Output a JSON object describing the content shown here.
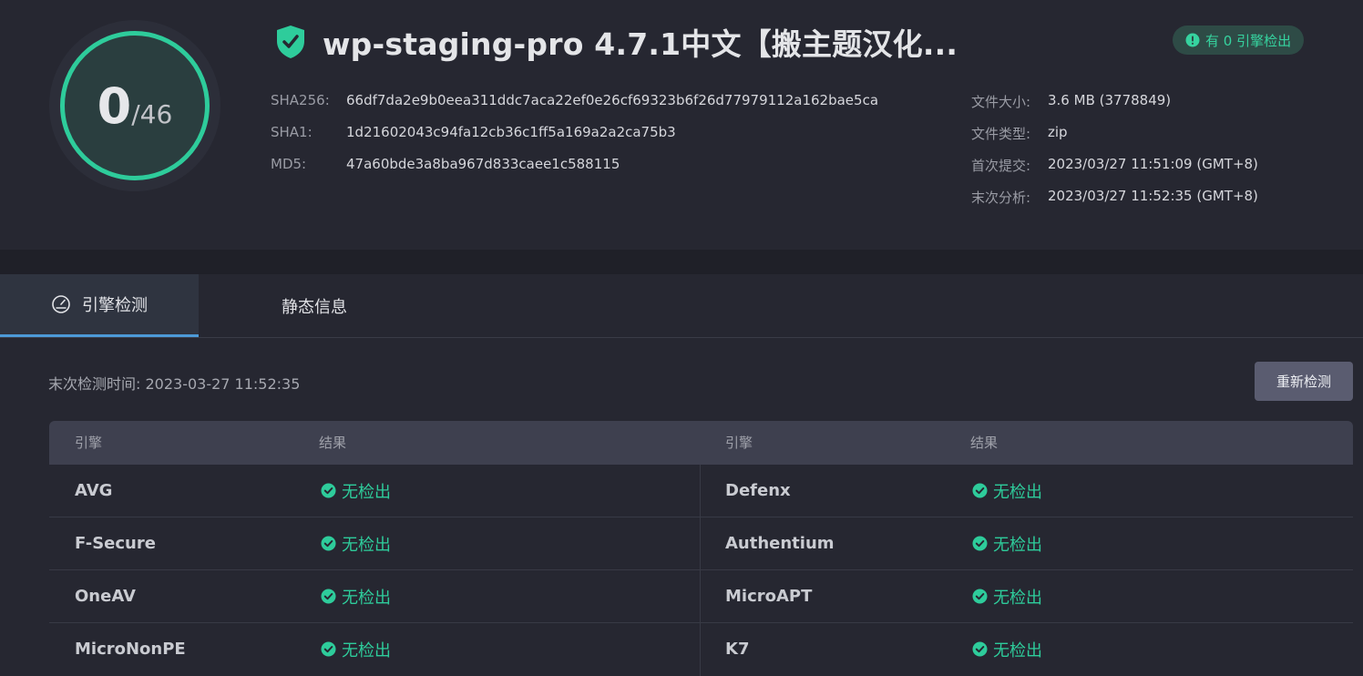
{
  "score": {
    "detected": "0",
    "total": "/46"
  },
  "file": {
    "title": "wp-staging-pro 4.7.1中文【搬主题汉化..."
  },
  "badge": {
    "label": "有 0 引擎检出"
  },
  "hashes": [
    {
      "key": "SHA256:",
      "value": "66df7da2e9b0eea311ddc7aca22ef0e26cf69323b6f26d77979112a162bae5ca"
    },
    {
      "key": "SHA1:",
      "value": "1d21602043c94fa12cb36c1ff5a169a2a2ca75b3"
    },
    {
      "key": "MD5:",
      "value": "47a60bde3a8ba967d833caee1c588115"
    }
  ],
  "meta": [
    {
      "key": "文件大小:",
      "value": "3.6 MB (3778849)"
    },
    {
      "key": "文件类型:",
      "value": "zip"
    },
    {
      "key": "首次提交:",
      "value": "2023/03/27 11:51:09 (GMT+8)"
    },
    {
      "key": "末次分析:",
      "value": "2023/03/27 11:52:35 (GMT+8)"
    }
  ],
  "tabs": [
    {
      "label": "引擎检测",
      "icon": "gauge-icon",
      "active": true
    },
    {
      "label": "静态信息",
      "active": false
    }
  ],
  "scan": {
    "last_scan": "末次检测时间: 2023-03-27 11:52:35",
    "rescan_label": "重新检测"
  },
  "table": {
    "headers": [
      "引擎",
      "结果",
      "引擎",
      "结果"
    ],
    "rows": [
      {
        "left": {
          "engine": "AVG",
          "result": "无检出"
        },
        "right": {
          "engine": "Defenx",
          "result": "无检出"
        }
      },
      {
        "left": {
          "engine": "F-Secure",
          "result": "无检出"
        },
        "right": {
          "engine": "Authentium",
          "result": "无检出"
        }
      },
      {
        "left": {
          "engine": "OneAV",
          "result": "无检出"
        },
        "right": {
          "engine": "MicroAPT",
          "result": "无检出"
        }
      },
      {
        "left": {
          "engine": "MicroNonPE",
          "result": "无检出"
        },
        "right": {
          "engine": "K7",
          "result": "无检出"
        }
      }
    ]
  },
  "colors": {
    "accent": "#2ecc9b",
    "tab_underline": "#4d9ad8",
    "background": "#262731"
  }
}
